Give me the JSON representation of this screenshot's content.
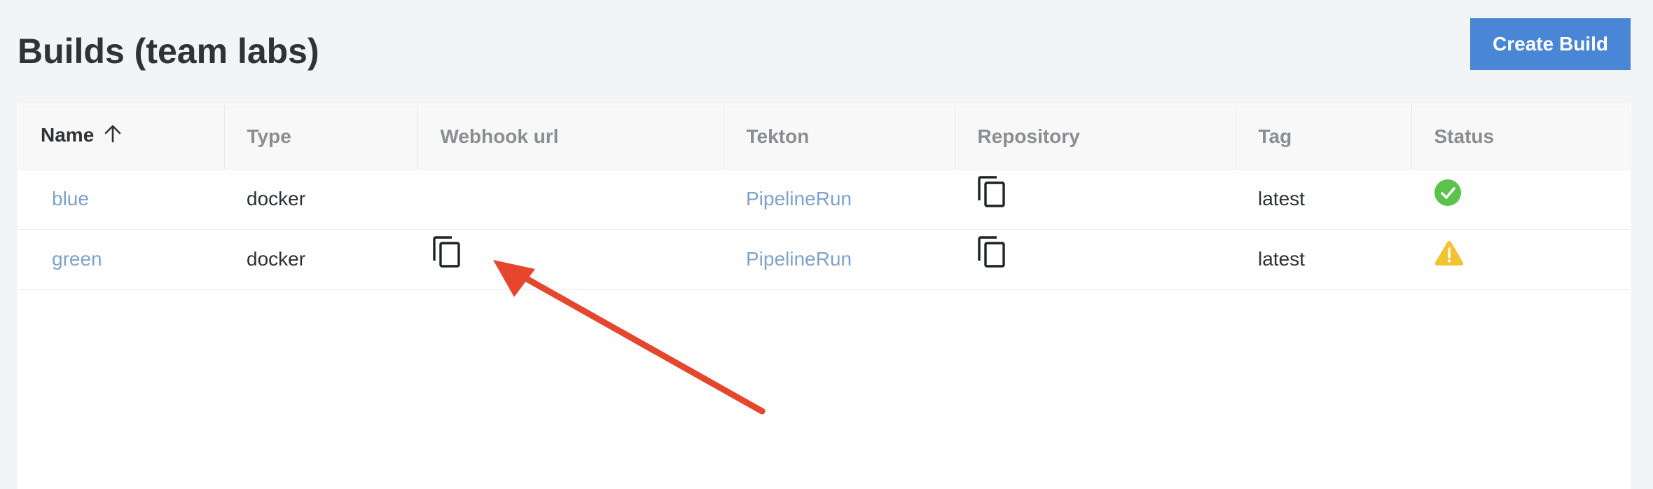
{
  "page": {
    "title": "Builds (team labs)",
    "create_button": "Create Build"
  },
  "table": {
    "columns": [
      "Name",
      "Type",
      "Webhook url",
      "Tekton",
      "Repository",
      "Tag",
      "Status"
    ],
    "sort": {
      "column": "Name",
      "direction": "ascending"
    },
    "rows": [
      {
        "name": "blue",
        "type": "docker",
        "webhook_copy": false,
        "tekton": "PipelineRun",
        "repository_copy": true,
        "tag": "latest",
        "status": "success"
      },
      {
        "name": "green",
        "type": "docker",
        "webhook_copy": true,
        "tekton": "PipelineRun",
        "repository_copy": true,
        "tag": "latest",
        "status": "warning"
      }
    ]
  },
  "colors": {
    "accent": "#4a86d6",
    "link": "#7ea2cc",
    "status_success": "#5cc24a",
    "status_warning": "#f2c230",
    "annotation_arrow": "#e5462d"
  },
  "icons": {
    "sort": "arrow-up-icon",
    "copy": "copy-icon",
    "success": "check-circle-icon",
    "warning": "warning-triangle-icon"
  }
}
